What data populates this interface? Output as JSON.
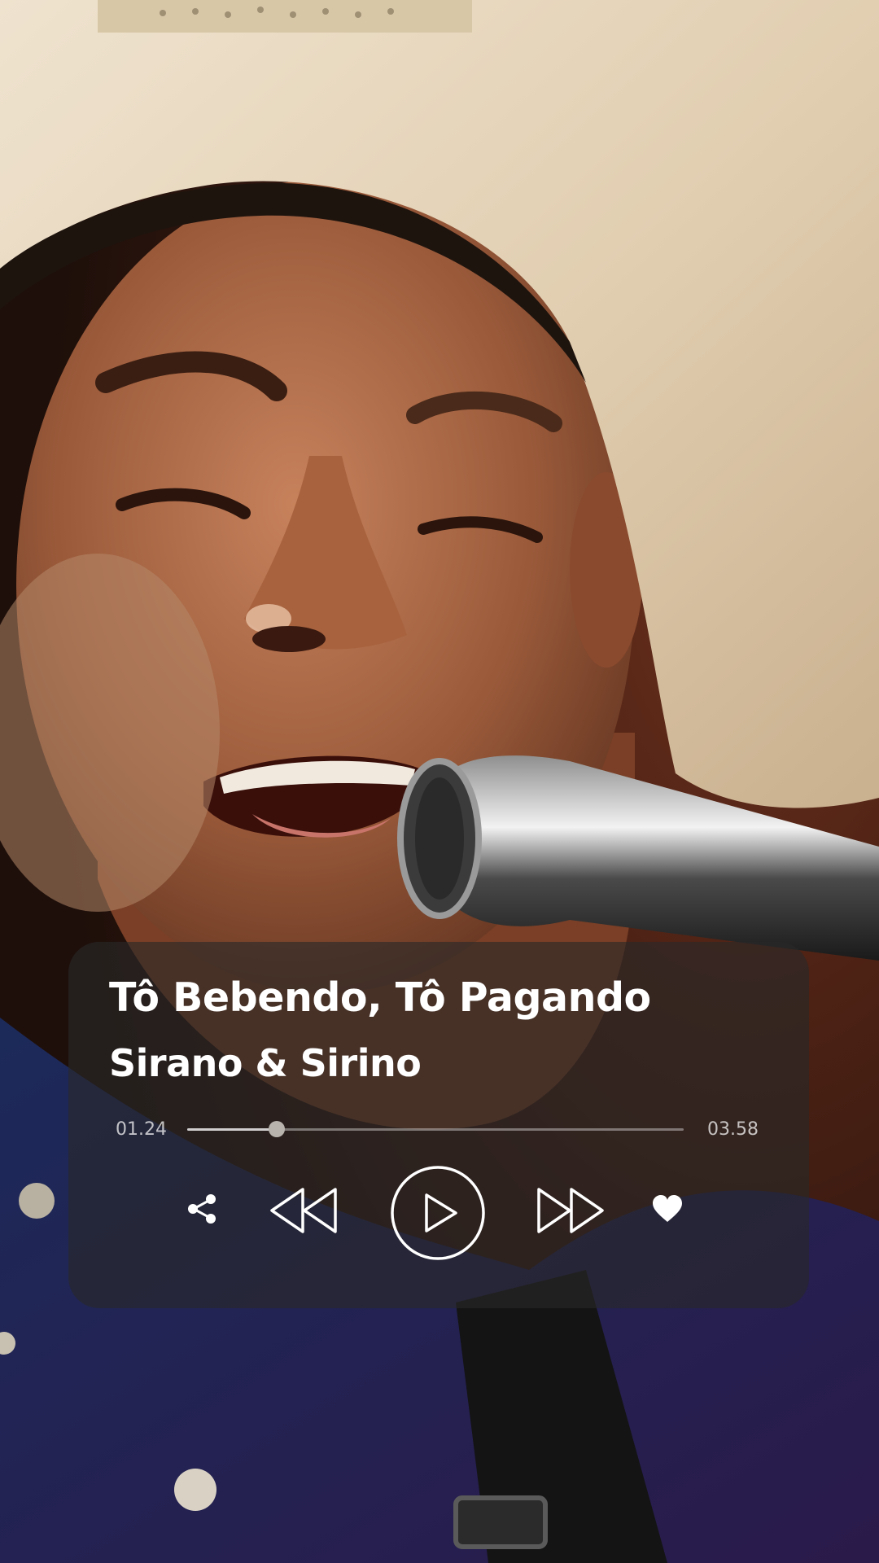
{
  "player": {
    "title": "Tô Bebendo, Tô Pagando",
    "artist": "Sirano & Sirino",
    "current_time": "01.24",
    "total_time": "03.58",
    "progress": 0.18,
    "controls": {
      "share_icon": "share-icon",
      "rewind_icon": "rewind-icon",
      "play_icon": "play-icon",
      "fast_forward_icon": "fast-forward-icon",
      "like_icon": "heart-icon"
    }
  },
  "colors": {
    "card_background": "#282828",
    "text": "#ffffff",
    "muted_text": "#b8b8b8",
    "track": "#8a8a8a",
    "thumb": "#b9b3ae"
  }
}
